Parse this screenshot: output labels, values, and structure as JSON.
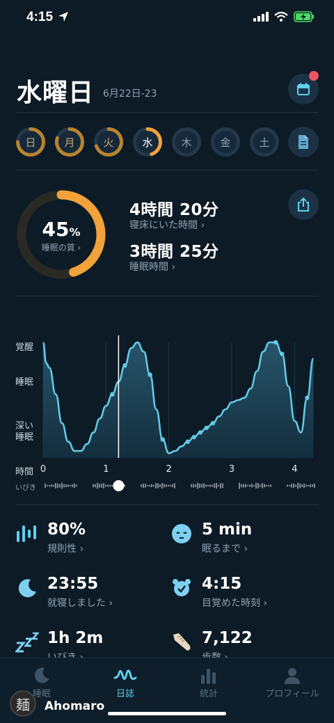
{
  "status_bar": {
    "time": "4:15"
  },
  "header": {
    "day": "水曜日",
    "date_range": "6月22日-23"
  },
  "week_days": [
    {
      "label": "日",
      "quality": 0.75,
      "color": "#b9832e"
    },
    {
      "label": "月",
      "quality": 0.8,
      "color": "#b9832e"
    },
    {
      "label": "火",
      "quality": 0.7,
      "color": "#b9832e"
    },
    {
      "label": "水",
      "quality": 0.45,
      "color": "#f2a23a"
    },
    {
      "label": "木",
      "quality": 0,
      "color": ""
    },
    {
      "label": "金",
      "quality": 0,
      "color": ""
    },
    {
      "label": "土",
      "quality": 0,
      "color": ""
    }
  ],
  "summary": {
    "quality_value": "45",
    "quality_unit": "%",
    "quality_fraction": 0.45,
    "quality_label": "睡眠の質 ›",
    "in_bed_value": "4時間 20分",
    "in_bed_label": "寝床にいた時間 ›",
    "asleep_value": "3時間 25分",
    "asleep_label": "睡眠時間 ›"
  },
  "chart_data": {
    "type": "area",
    "y_categories": [
      "覚醒",
      "睡眠",
      "深い睡眠"
    ],
    "x_label": "時間",
    "x_ticks": [
      "0",
      "1",
      "2",
      "3",
      "4"
    ],
    "xlim": [
      0,
      4.35
    ],
    "ylim": [
      0,
      1
    ],
    "snore_label": "いびき",
    "cursor_x": 1.2,
    "series": [
      {
        "x": [
          0,
          0.05,
          0.1,
          0.2,
          0.3,
          0.4,
          0.5,
          0.6,
          0.7,
          0.8,
          0.9,
          1.0,
          1.1,
          1.2,
          1.3,
          1.4,
          1.5,
          1.6,
          1.7,
          1.8,
          1.9,
          2.0,
          2.1,
          2.2,
          2.3,
          2.4,
          2.5,
          2.6,
          2.7,
          2.8,
          2.9,
          3.0,
          3.1,
          3.2,
          3.3,
          3.4,
          3.5,
          3.6,
          3.7,
          3.8,
          3.9,
          4.0,
          4.1,
          4.2,
          4.3
        ],
        "y": [
          1.0,
          0.82,
          0.78,
          0.55,
          0.3,
          0.14,
          0.06,
          0.06,
          0.12,
          0.22,
          0.34,
          0.45,
          0.55,
          0.66,
          0.8,
          0.95,
          1.0,
          0.92,
          0.72,
          0.42,
          0.16,
          0.04,
          0.06,
          0.1,
          0.14,
          0.18,
          0.22,
          0.26,
          0.3,
          0.36,
          0.42,
          0.48,
          0.5,
          0.52,
          0.6,
          0.75,
          0.92,
          1.0,
          1.0,
          0.9,
          0.62,
          0.32,
          0.22,
          0.52,
          0.86
        ]
      }
    ]
  },
  "stats": [
    {
      "value": "80%",
      "label": "規則性 ›",
      "icon": "regularity-bars-icon"
    },
    {
      "value": "5 min",
      "label": "眠るまで ›",
      "icon": "sleepy-face-icon"
    },
    {
      "value": "23:55",
      "label": "就寝しました ›",
      "icon": "moon-icon"
    },
    {
      "value": "4:15",
      "label": "目覚めた時刻 ›",
      "icon": "alarm-clock-icon"
    },
    {
      "value": "1h  2m",
      "label": "いびき ›",
      "icon": "zzz-icon"
    },
    {
      "value": "7,122",
      "label": "歩数 ›",
      "icon": "shoe-icon"
    }
  ],
  "tabs": [
    {
      "label": "睡眠",
      "icon": "moon-icon",
      "active": false
    },
    {
      "label": "日誌",
      "icon": "waveform-icon",
      "active": true
    },
    {
      "label": "統計",
      "icon": "bar-chart-icon",
      "active": false
    },
    {
      "label": "プロフィール",
      "icon": "person-icon",
      "active": false
    }
  ],
  "overlay": {
    "avatar_glyph": "麺",
    "username": "Ahomaro"
  },
  "colors": {
    "accent": "#5fd0f0",
    "orange": "#f2a23a",
    "background": "#0d1b26"
  }
}
